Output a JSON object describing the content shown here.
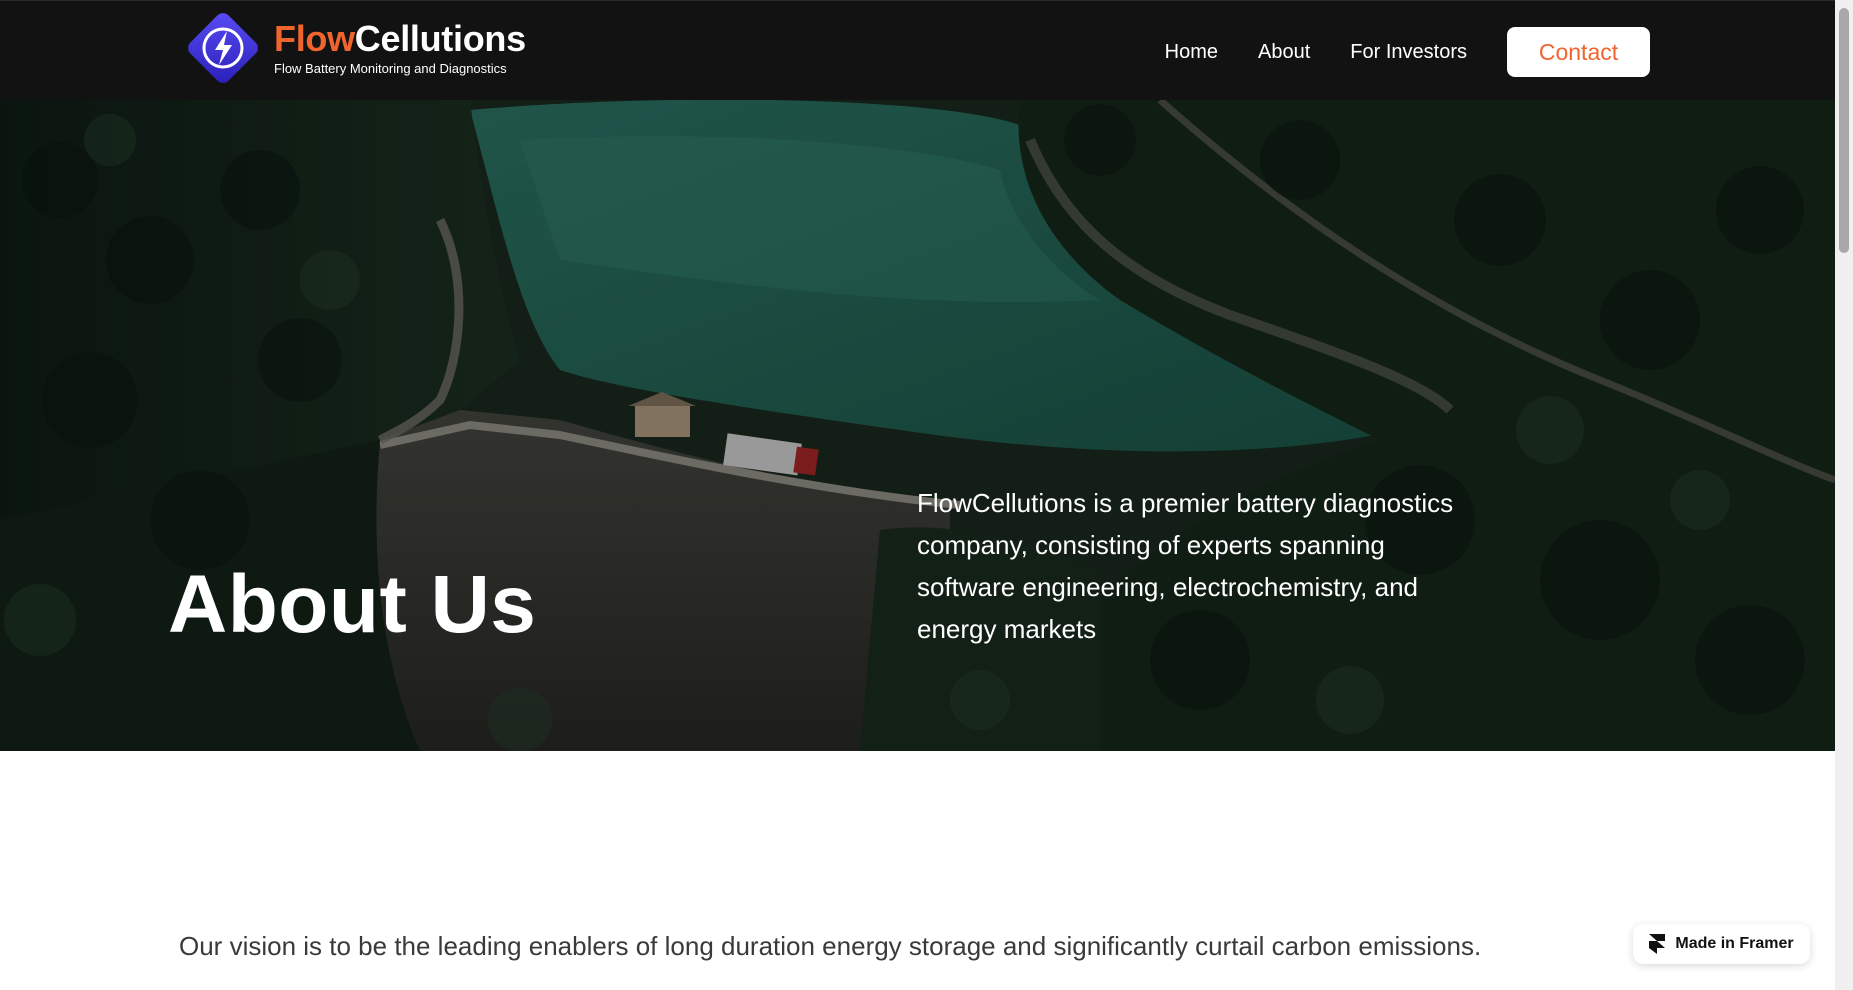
{
  "header": {
    "logo_title_part1": "Flow",
    "logo_title_part2": "Cellutions",
    "logo_subtitle": "Flow Battery Monitoring and Diagnostics",
    "nav": [
      {
        "label": "Home"
      },
      {
        "label": "About"
      },
      {
        "label": "For Investors"
      }
    ],
    "contact_label": "Contact"
  },
  "hero": {
    "title": "About Us",
    "description": "FlowCellutions is a premier battery diagnostics company, consisting of experts spanning software engineering, electrochemistry, and energy markets"
  },
  "vision": {
    "text": "Our vision is to be the leading enablers of long duration energy storage and significantly curtail carbon emissions."
  },
  "badge": {
    "label": "Made in Framer"
  },
  "colors": {
    "accent": "#f0642e",
    "header_bg": "#121212",
    "logo_blue": "#3b2fd9"
  },
  "icons": {
    "logo": "lightning-bolt-diamond-icon",
    "framer": "framer-logo-icon"
  }
}
